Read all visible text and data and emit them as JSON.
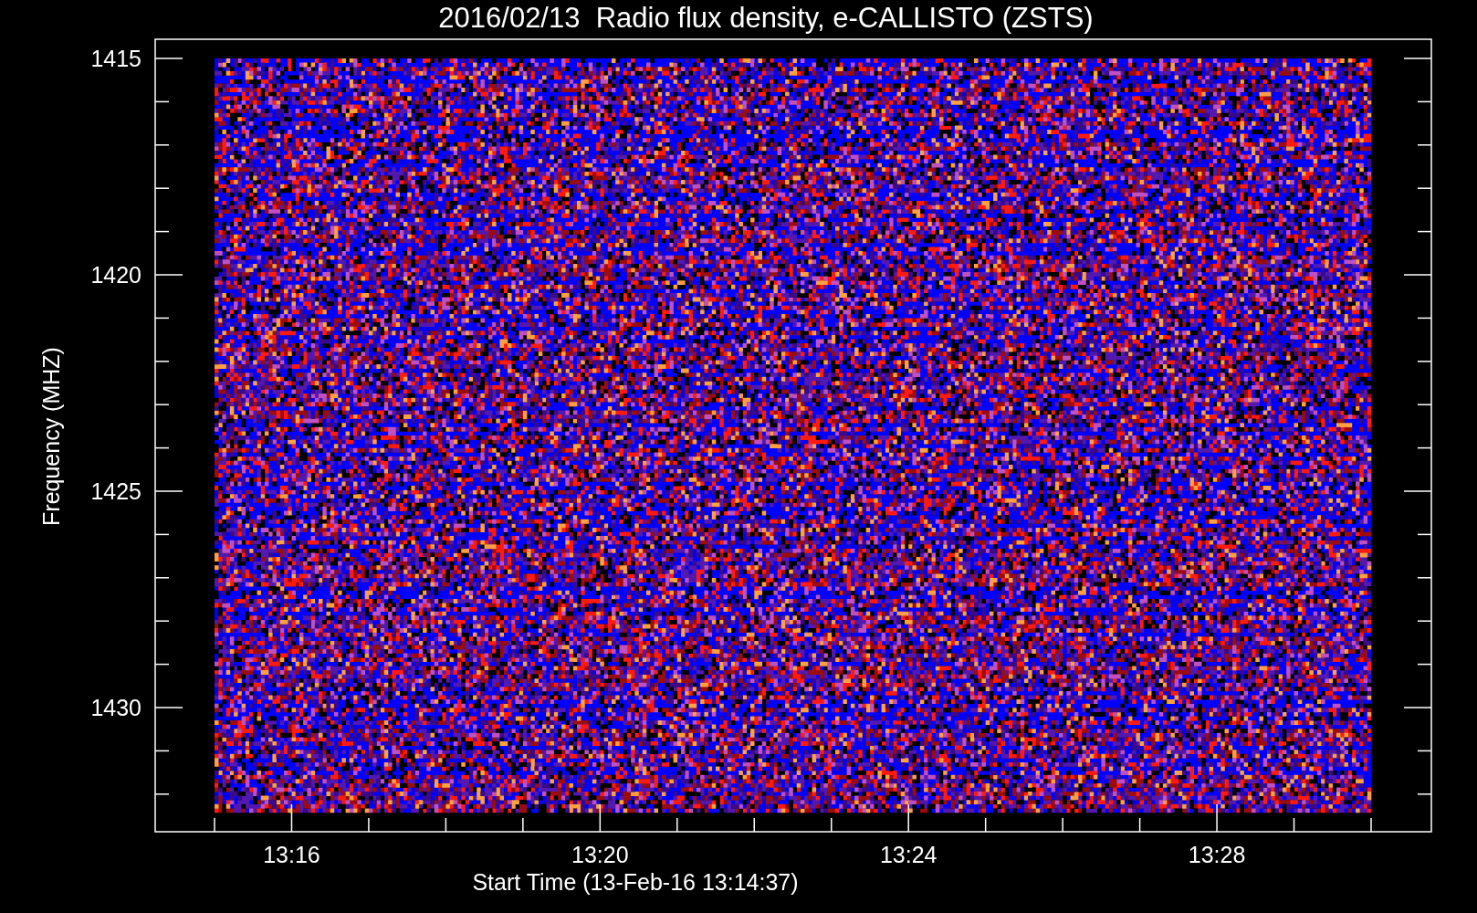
{
  "plot": {
    "title": "2016/02/13  Radio flux density, e-CALLISTO (ZSTS)",
    "ylabel": "Frequency (MHZ)",
    "xlabel": "Start Time (13-Feb-16 13:14:37)",
    "yticks": [
      "1415",
      "1420",
      "1425",
      "1430"
    ],
    "xticks": [
      "13:16",
      "13:20",
      "13:24",
      "13:28"
    ]
  }
}
